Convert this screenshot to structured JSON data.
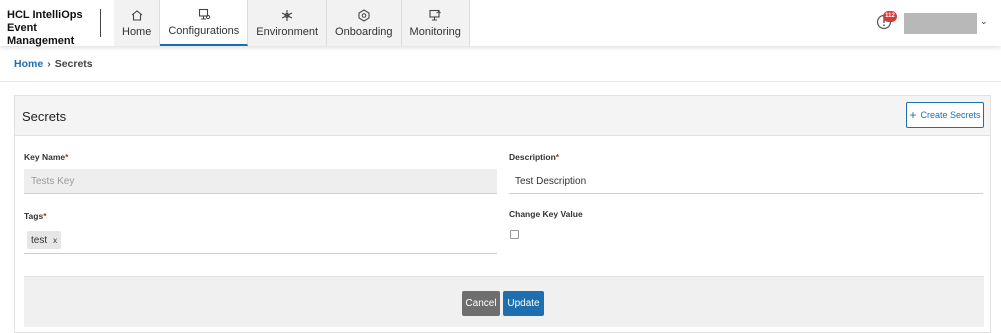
{
  "header": {
    "brand_line1": "HCL IntelliOps",
    "brand_line2": "Event Management",
    "nav": [
      {
        "label": "Home",
        "icon": "home-icon"
      },
      {
        "label": "Configurations",
        "icon": "configurations-icon",
        "active": true
      },
      {
        "label": "Environment",
        "icon": "environment-icon"
      },
      {
        "label": "Onboarding",
        "icon": "onboarding-icon"
      },
      {
        "label": "Monitoring",
        "icon": "monitoring-icon"
      }
    ],
    "alert_count": "112",
    "user_caret": "⌄"
  },
  "breadcrumb": {
    "home": "Home",
    "separator": "›",
    "current": "Secrets"
  },
  "card": {
    "title": "Secrets",
    "create_button": "Create Secrets",
    "create_icon": "+"
  },
  "form": {
    "key_name_label": "Key Name",
    "key_name_value": "Tests Key",
    "description_label": "Description",
    "description_value": "Test Description",
    "tags_label": "Tags",
    "tags": [
      "test"
    ],
    "tag_remove": "x",
    "change_key_label": "Change Key Value",
    "change_key_checked": false,
    "required_marker": "*"
  },
  "footer": {
    "cancel": "Cancel",
    "update": "Update"
  },
  "colors": {
    "accent": "#1d6fb0",
    "required": "#c62828",
    "badge": "#d63a3a",
    "cancel": "#6e6e6e"
  }
}
